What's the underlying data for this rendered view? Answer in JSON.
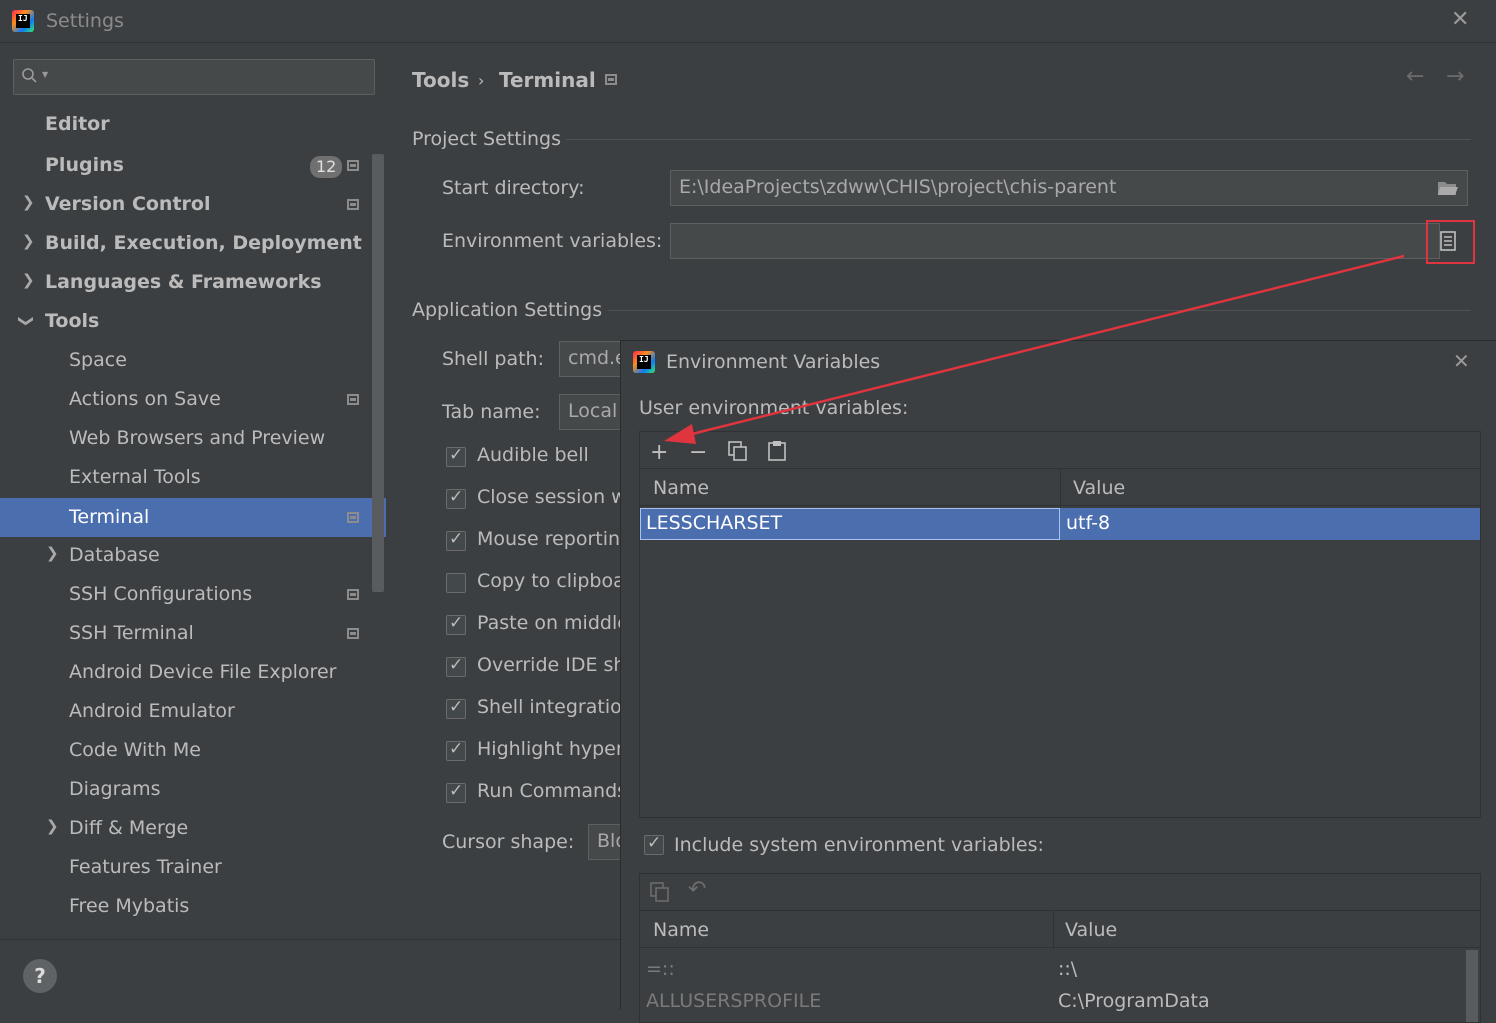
{
  "window": {
    "title": "Settings"
  },
  "search": {
    "placeholder": ""
  },
  "sidebar": {
    "items": [
      {
        "label": "Editor"
      },
      {
        "label": "Plugins",
        "badge": "12"
      },
      {
        "label": "Version Control"
      },
      {
        "label": "Build, Execution, Deployment"
      },
      {
        "label": "Languages & Frameworks"
      },
      {
        "label": "Tools"
      },
      {
        "label": "Space"
      },
      {
        "label": "Actions on Save"
      },
      {
        "label": "Web Browsers and Preview"
      },
      {
        "label": "External Tools"
      },
      {
        "label": "Terminal"
      },
      {
        "label": "Database"
      },
      {
        "label": "SSH Configurations"
      },
      {
        "label": "SSH Terminal"
      },
      {
        "label": "Android Device File Explorer"
      },
      {
        "label": "Android Emulator"
      },
      {
        "label": "Code With Me"
      },
      {
        "label": "Diagrams"
      },
      {
        "label": "Diff & Merge"
      },
      {
        "label": "Features Trainer"
      },
      {
        "label": "Free Mybatis"
      }
    ]
  },
  "header": {
    "crumb_parent": "Tools",
    "crumb_sep": "›",
    "crumb_current": "Terminal"
  },
  "project": {
    "section_title": "Project Settings",
    "start_dir_label": "Start directory:",
    "start_dir_value": "E:\\IdeaProjects\\zdww\\CHIS\\project\\chis-parent",
    "env_label": "Environment variables:",
    "env_value": ""
  },
  "app": {
    "section_title": "Application Settings",
    "shell_label": "Shell path:",
    "shell_value": "cmd.e",
    "tab_label": "Tab name:",
    "tab_value": "Local",
    "checks": [
      {
        "label": "Audible bell",
        "checked": true
      },
      {
        "label": "Close session w",
        "checked": true
      },
      {
        "label": "Mouse reportin",
        "checked": true
      },
      {
        "label": "Copy to clipboa",
        "checked": false
      },
      {
        "label": "Paste on middle",
        "checked": true
      },
      {
        "label": "Override IDE sh",
        "checked": true
      },
      {
        "label": "Shell integratio",
        "checked": true
      },
      {
        "label": "Highlight hyper",
        "checked": true
      },
      {
        "label": "Run Commands",
        "checked": true
      }
    ],
    "cursor_label": "Cursor shape:",
    "cursor_value": "Blo"
  },
  "dialog": {
    "title": "Environment Variables",
    "user_label": "User environment variables:",
    "user_table": {
      "headers": [
        "Name",
        "Value"
      ],
      "rows": [
        {
          "name": "LESSCHARSET",
          "value": "utf-8"
        }
      ]
    },
    "include_label": "Include system environment variables:",
    "include_checked": true,
    "system_table": {
      "headers": [
        "Name",
        "Value"
      ],
      "rows": [
        {
          "name": "=::",
          "value": "::\\"
        },
        {
          "name": "ALLUSERSPROFILE",
          "value": "C:\\ProgramData"
        }
      ]
    }
  },
  "help": {
    "label": "?"
  },
  "colors": {
    "selection": "#4b6eaf",
    "annotation": "#e0343f"
  }
}
